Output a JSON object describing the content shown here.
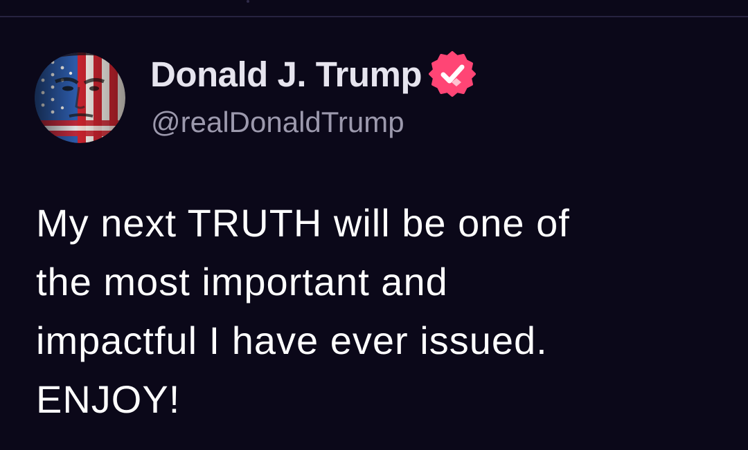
{
  "colors": {
    "background": "#0b0819",
    "divider": "#272340",
    "author_name": "#e6e4ee",
    "handle": "#9c99ad",
    "post_text": "#ffffff",
    "verified_badge": "#ff4575"
  },
  "author": {
    "name": "Donald J. Trump",
    "handle": "@realDonaldTrump",
    "verified_icon": "verified-badge-icon",
    "avatar_icon": "avatar-image"
  },
  "post": {
    "lines": [
      "My next TRUTH will be one of",
      "the most important and",
      "impactful I have ever issued.",
      "ENJOY!"
    ]
  }
}
